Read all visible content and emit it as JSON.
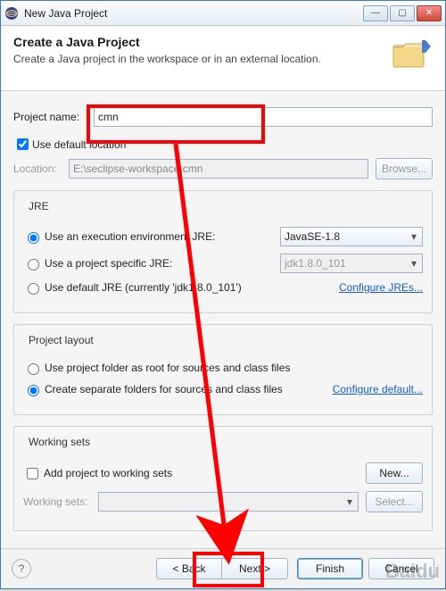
{
  "window": {
    "title": "New Java Project"
  },
  "banner": {
    "title": "Create a Java Project",
    "subtitle": "Create a Java project in the workspace or in an external location."
  },
  "project": {
    "name_label": "Project name:",
    "name_value": "cmn",
    "use_default_label": "Use default location",
    "use_default_checked": true,
    "location_label": "Location:",
    "location_value": "E:\\seclipse-workspace\\cmn",
    "browse_label": "Browse..."
  },
  "jre": {
    "legend": "JRE",
    "opt1_label": "Use an execution environment JRE:",
    "opt1_value": "JavaSE-1.8",
    "opt2_label": "Use a project specific JRE:",
    "opt2_value": "jdk1.8.0_101",
    "opt3_label": "Use default JRE (currently 'jdk1.8.0_101')",
    "configure_link": "Configure JREs...",
    "selected": 1
  },
  "layout": {
    "legend": "Project layout",
    "opt1_label": "Use project folder as root for sources and class files",
    "opt2_label": "Create separate folders for sources and class files",
    "configure_link": "Configure default...",
    "selected": 2
  },
  "ws": {
    "legend": "Working sets",
    "add_label": "Add project to working sets",
    "add_checked": false,
    "combo_label": "Working sets:",
    "new_label": "New...",
    "select_label": "Select..."
  },
  "footer": {
    "back": "< Back",
    "next": "Next >",
    "finish": "Finish",
    "cancel": "Cancel"
  }
}
